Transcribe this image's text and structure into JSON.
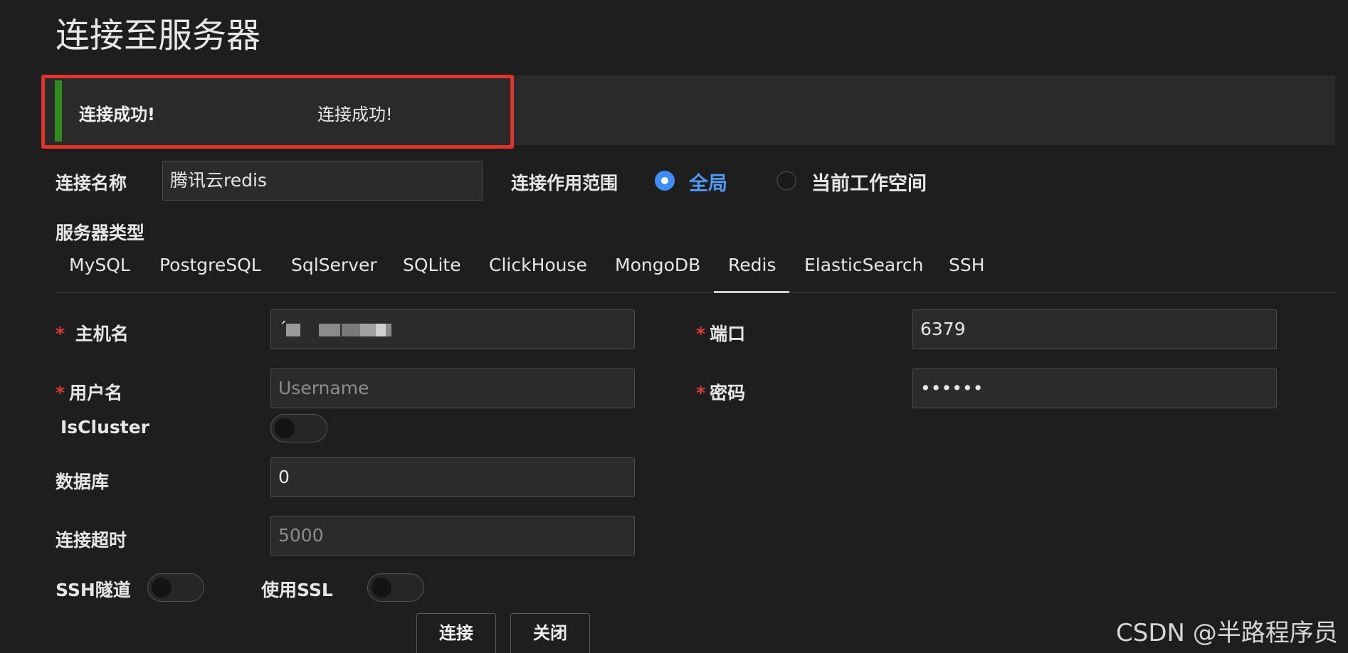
{
  "page_title": "连接至服务器",
  "alert": {
    "title": "连接成功!",
    "message": "连接成功!"
  },
  "connection_name": {
    "label": "连接名称",
    "value": "腾讯云redis"
  },
  "scope": {
    "label": "连接作用范围",
    "options": [
      {
        "label": "全局",
        "selected": true
      },
      {
        "label": "当前工作空间",
        "selected": false
      }
    ]
  },
  "server_type": {
    "label": "服务器类型",
    "tabs": [
      "MySQL",
      "PostgreSQL",
      "SqlServer",
      "SQLite",
      "ClickHouse",
      "MongoDB",
      "Redis",
      "ElasticSearch",
      "SSH"
    ],
    "active": "Redis"
  },
  "form": {
    "required_mark": "*",
    "host": {
      "label": "主机名",
      "value": "´"
    },
    "port": {
      "label": "端口",
      "value": "6379"
    },
    "username": {
      "label": "用户名",
      "placeholder": "Username"
    },
    "password": {
      "label": "密码",
      "value": "••••••"
    },
    "is_cluster": {
      "label": "IsCluster",
      "enabled": false
    },
    "database": {
      "label": "数据库",
      "value": "0"
    },
    "timeout": {
      "label": "连接超时",
      "placeholder": "5000"
    },
    "ssh_tunnel": {
      "label": "SSH隧道",
      "enabled": false
    },
    "use_ssl": {
      "label": "使用SSL",
      "enabled": false
    }
  },
  "buttons": {
    "connect": "连接",
    "close": "关闭"
  },
  "watermark": "CSDN @半路程序员",
  "colors": {
    "background": "#1e1e1e",
    "accent_blue": "#3d8ef7",
    "success_green": "#2e8b1e",
    "highlight_red": "#e2332b",
    "required_red": "#e03b3b"
  }
}
